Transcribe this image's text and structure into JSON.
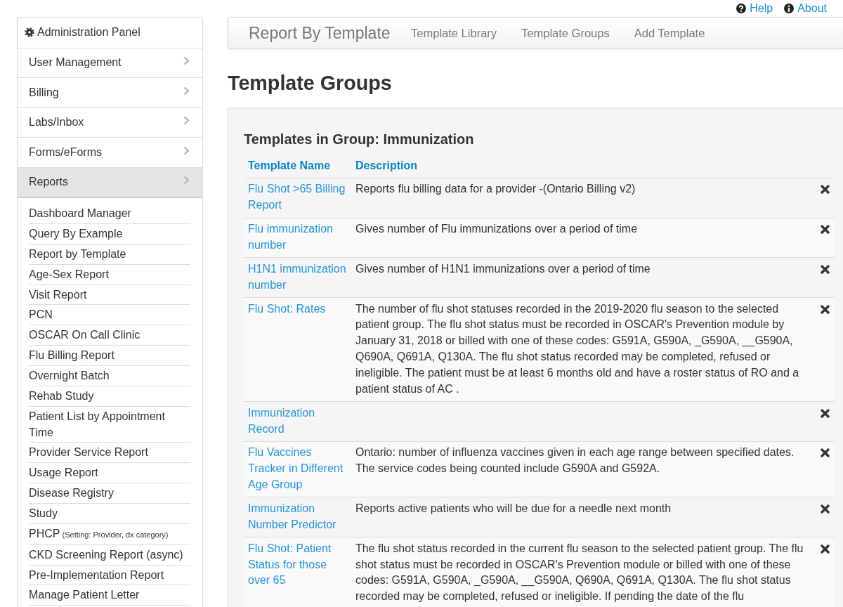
{
  "top_links": [
    {
      "kind": "help",
      "label": "Help"
    },
    {
      "kind": "info",
      "label": "About"
    }
  ],
  "sidebar": {
    "title": "Administration Panel",
    "items": [
      {
        "label": "User Management",
        "selected": false
      },
      {
        "label": "Billing",
        "selected": false
      },
      {
        "label": "Labs/Inbox",
        "selected": false
      },
      {
        "label": "Forms/eForms",
        "selected": false
      },
      {
        "label": "Reports",
        "selected": true
      }
    ],
    "sub_items": [
      {
        "label": "Dashboard Manager"
      },
      {
        "label": "Query By Example"
      },
      {
        "label": "Report by Template"
      },
      {
        "label": "Age-Sex Report"
      },
      {
        "label": "Visit Report"
      },
      {
        "label": "PCN"
      },
      {
        "label": "OSCAR On Call Clinic"
      },
      {
        "label": "Flu Billing Report"
      },
      {
        "label": "Overnight Batch"
      },
      {
        "label": "Rehab Study"
      },
      {
        "label": "Patient List by Appointment Time"
      },
      {
        "label": "Provider Service Report"
      },
      {
        "label": "Usage Report"
      },
      {
        "label": "Disease Registry"
      },
      {
        "label": "Study"
      },
      {
        "label": "PHCP",
        "note": "(Setting: Provider, dx category)"
      },
      {
        "label": "CKD Screening Report (async)"
      },
      {
        "label": "Pre-Implementation Report"
      },
      {
        "label": "Manage Patient Letter"
      }
    ]
  },
  "navbar": {
    "brand": "Report By Template",
    "links": [
      "Template Library",
      "Template Groups",
      "Add Template"
    ]
  },
  "heading": "Template Groups",
  "group": {
    "title": "Templates in Group: Immunization",
    "columns": [
      "Template Name",
      "Description"
    ],
    "rows": [
      {
        "name": "Flu Shot >65 Billing Report",
        "description": "Reports flu billing data for a provider -(Ontario Billing v2)"
      },
      {
        "name": "Flu immunization number",
        "description": "Gives number of Flu immunizations over a period of time"
      },
      {
        "name": "H1N1 immunization number",
        "description": "Gives number of H1N1 immunizations over a period of time"
      },
      {
        "name": "Flu Shot: Rates",
        "description": "The number of flu shot statuses recorded in the 2019-2020 flu season to the selected patient group. The flu shot status must be recorded in OSCAR's Prevention module by January 31, 2018 or billed with one of these codes: G591A, G590A, _G590A, __G590A, Q690A, Q691A, Q130A. The flu shot status recorded may be completed, refused or ineligible. The patient must be at least 6 months old and have a roster status of RO and a patient status of AC ."
      },
      {
        "name": "Immunization Record"
      },
      {
        "name": "Flu Vaccines Tracker in Different Age Group",
        "description": "Ontario: number of influenza vaccines given in each age range between specified dates. The service codes being counted include G590A and G592A."
      },
      {
        "name": "Immunization Number Predictor",
        "description": "Reports active patients who will be due for a needle next month"
      },
      {
        "name": "Flu Shot: Patient Status for those over 65",
        "description": "The flu shot status recorded in the current flu season to the selected patient group. The flu shot status must be recorded in OSCAR's Prevention module or billed with one of these codes: G591A, G590A, _G590A, __G590A, Q690A, Q691A, Q130A. The flu shot status recorded may be completed, refused or ineligible. If pending the date of the flu"
      }
    ]
  }
}
